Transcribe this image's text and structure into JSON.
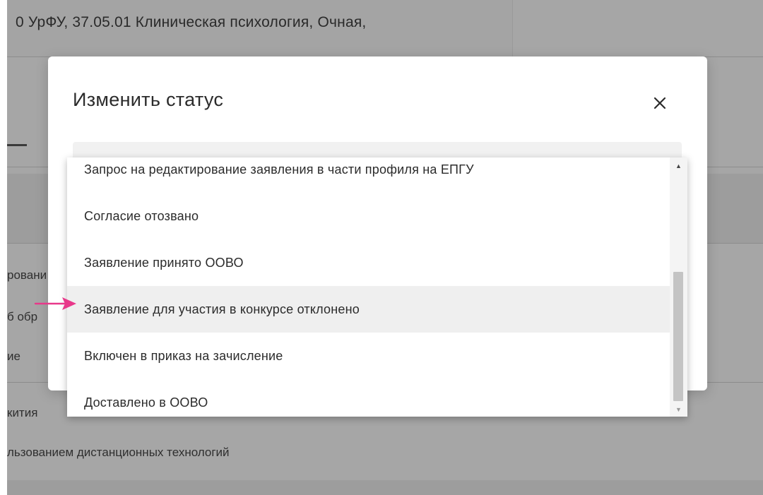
{
  "background": {
    "header_text": "0 УрФУ, 37.05.01 Клиническая психология, Очная,",
    "left_fragments": [
      "ровани",
      "б обр",
      "ие",
      "кития"
    ],
    "bottom_text": "льзованием дистанционных технологий"
  },
  "modal": {
    "title": "Изменить статус",
    "close_icon": "close-icon"
  },
  "dropdown": {
    "options": [
      "Запрос на редактирование заявления в части профиля на ЕПГУ",
      "Согласие отозвано",
      "Заявление принято ООВО",
      "Заявление для участия в конкурсе отклонено",
      "Включен в приказ на зачисление",
      "Доставлено в ООВО"
    ],
    "highlighted_index": 3
  },
  "colors": {
    "annotation_arrow": "#e8388a",
    "overlay": "#a6a6a6",
    "highlight": "#efefef"
  }
}
